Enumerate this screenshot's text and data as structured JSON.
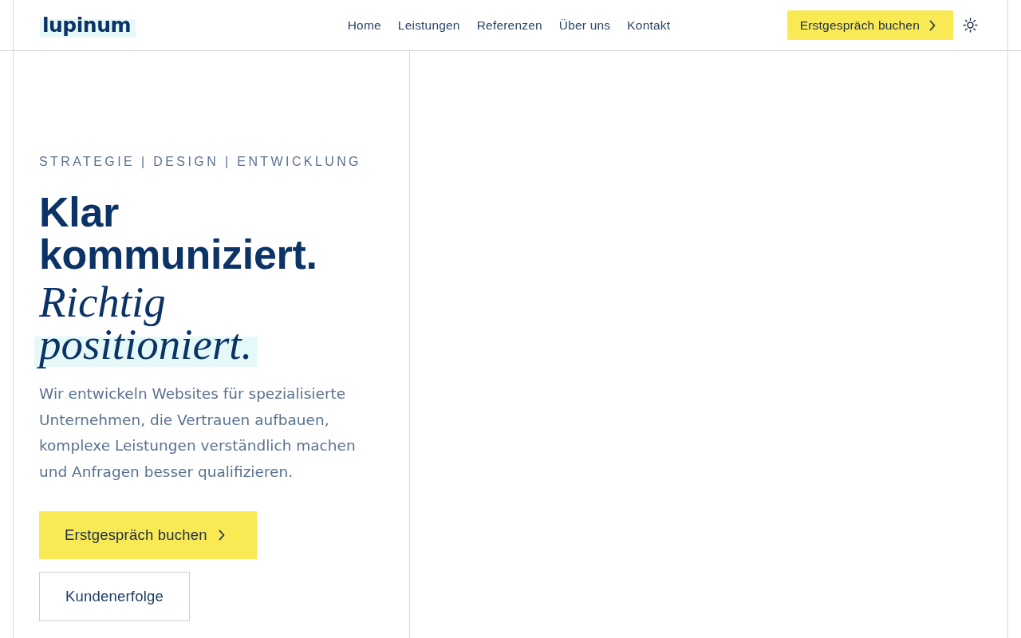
{
  "header": {
    "logo": "lupinum",
    "nav": [
      {
        "label": "Home"
      },
      {
        "label": "Leistungen"
      },
      {
        "label": "Referenzen"
      },
      {
        "label": "Über uns"
      },
      {
        "label": "Kontakt"
      }
    ],
    "cta": {
      "label": "Erstgespräch buchen"
    }
  },
  "hero": {
    "eyebrow": "STRATEGIE | DESIGN | ENTWICKLUNG",
    "heading": "Klar kommuniziert.",
    "accent": [
      {
        "text": "Richtig",
        "highlighted": false
      },
      {
        "text": "positioniert.",
        "highlighted": true
      }
    ],
    "description": "Wir entwickeln Websites für spezialisierte Unternehmen, die Vertrauen aufbauen, komplexe Leistungen verständlich machen und Anfragen besser qualifizieren.",
    "buttons": [
      {
        "label": "Erstgespräch buchen",
        "kind": "primary"
      },
      {
        "label": "Kundenerfolge",
        "kind": "secondary"
      }
    ]
  }
}
